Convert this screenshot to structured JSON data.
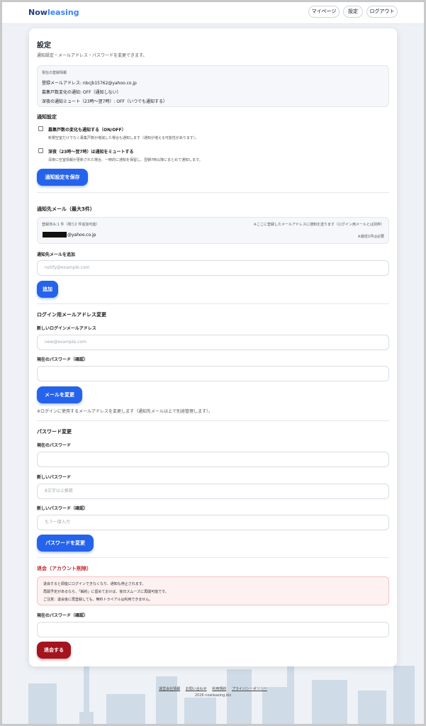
{
  "header": {
    "logo_part1": "Now",
    "logo_part2": "leasing",
    "nav": [
      {
        "label": "マイページ"
      },
      {
        "label": "設定"
      },
      {
        "label": "ログアウト"
      }
    ]
  },
  "page": {
    "title": "設定",
    "subtitle": "通知設定・メールアドレス・パスワードを変更できます。"
  },
  "current_info": {
    "heading": "現在の登録情報",
    "email_line": "登録メールアドレス: nbcjb15762@yahoo.co.jp",
    "recruit_line": "募集戸数変化の通知: OFF（通知しない）",
    "night_line": "深夜の通知ミュート（23時〜翌7時）: OFF（いつでも通知する）"
  },
  "notify": {
    "heading": "通知設定",
    "option1_label": "募集戸数の変化も通知する（ON/OFF）",
    "option1_desc": "新規空室だけでなく募集戸数が増減した場合も通知します（通知が増える可能性があります）。",
    "option1_checked": false,
    "option2_label": "深夜（23時〜翌7時）は通知をミュートする",
    "option2_desc": "深夜に空室情報が更新された場合、一時的に通知を保留し、翌朝7時以降にまとめて通知します。",
    "option2_checked": false,
    "save_label": "通知設定を保存"
  },
  "notify_email": {
    "heading": "通知先メール（最大3件）",
    "count_text": "登録済み:1 件（残り2 件追加可能）",
    "note_right": "※ここに登録したメールアドレスに通知を送ります（ログイン用メールとは別枠）",
    "email_suffix": "@yahoo.co.jp",
    "required_note": "※最低1件は必要",
    "add_label": "通知先メールを追加",
    "add_placeholder": "notify@example.com",
    "add_button": "追加"
  },
  "login_email": {
    "heading": "ログイン用メールアドレス変更",
    "new_label": "新しいログインメールアドレス",
    "new_placeholder": "new@example.com",
    "pw_label": "現在のパスワード（確認）",
    "pw_placeholder": "",
    "button": "メールを変更",
    "note": "※ログインに使用するメールアドレスを変更します（通知先メールは上で別途管理します）。"
  },
  "password": {
    "heading": "パスワード変更",
    "current_label": "現在のパスワード",
    "current_placeholder": "",
    "new_label": "新しいパスワード",
    "new_placeholder": "8文字以上推奨",
    "confirm_label": "新しいパスワード（確認）",
    "confirm_placeholder": "もう一度入力",
    "button": "パスワードを変更"
  },
  "withdraw": {
    "heading": "退会（アカウント削除）",
    "warn1": "退会すると即座にログインできなくなり、通知も停止されます。",
    "warn2": "再開予定があるなら、「解約」に留めておけば、後日スムーズに再開可能です。",
    "warn3": "ご注意：退会後に再登録しても、無料トライアルは利用できません。",
    "pw_label": "現在のパスワード（確認）",
    "pw_placeholder": "",
    "button": "退会する"
  },
  "footer": {
    "links": [
      "運営会社情報",
      "お問い合わせ",
      "利用規約",
      "プライバシーポリシー"
    ],
    "copyright": "2026 nowleasing.biz"
  },
  "colors": {
    "primary": "#2563eb",
    "danger": "#a3141e",
    "danger_heading": "#c0262d"
  }
}
